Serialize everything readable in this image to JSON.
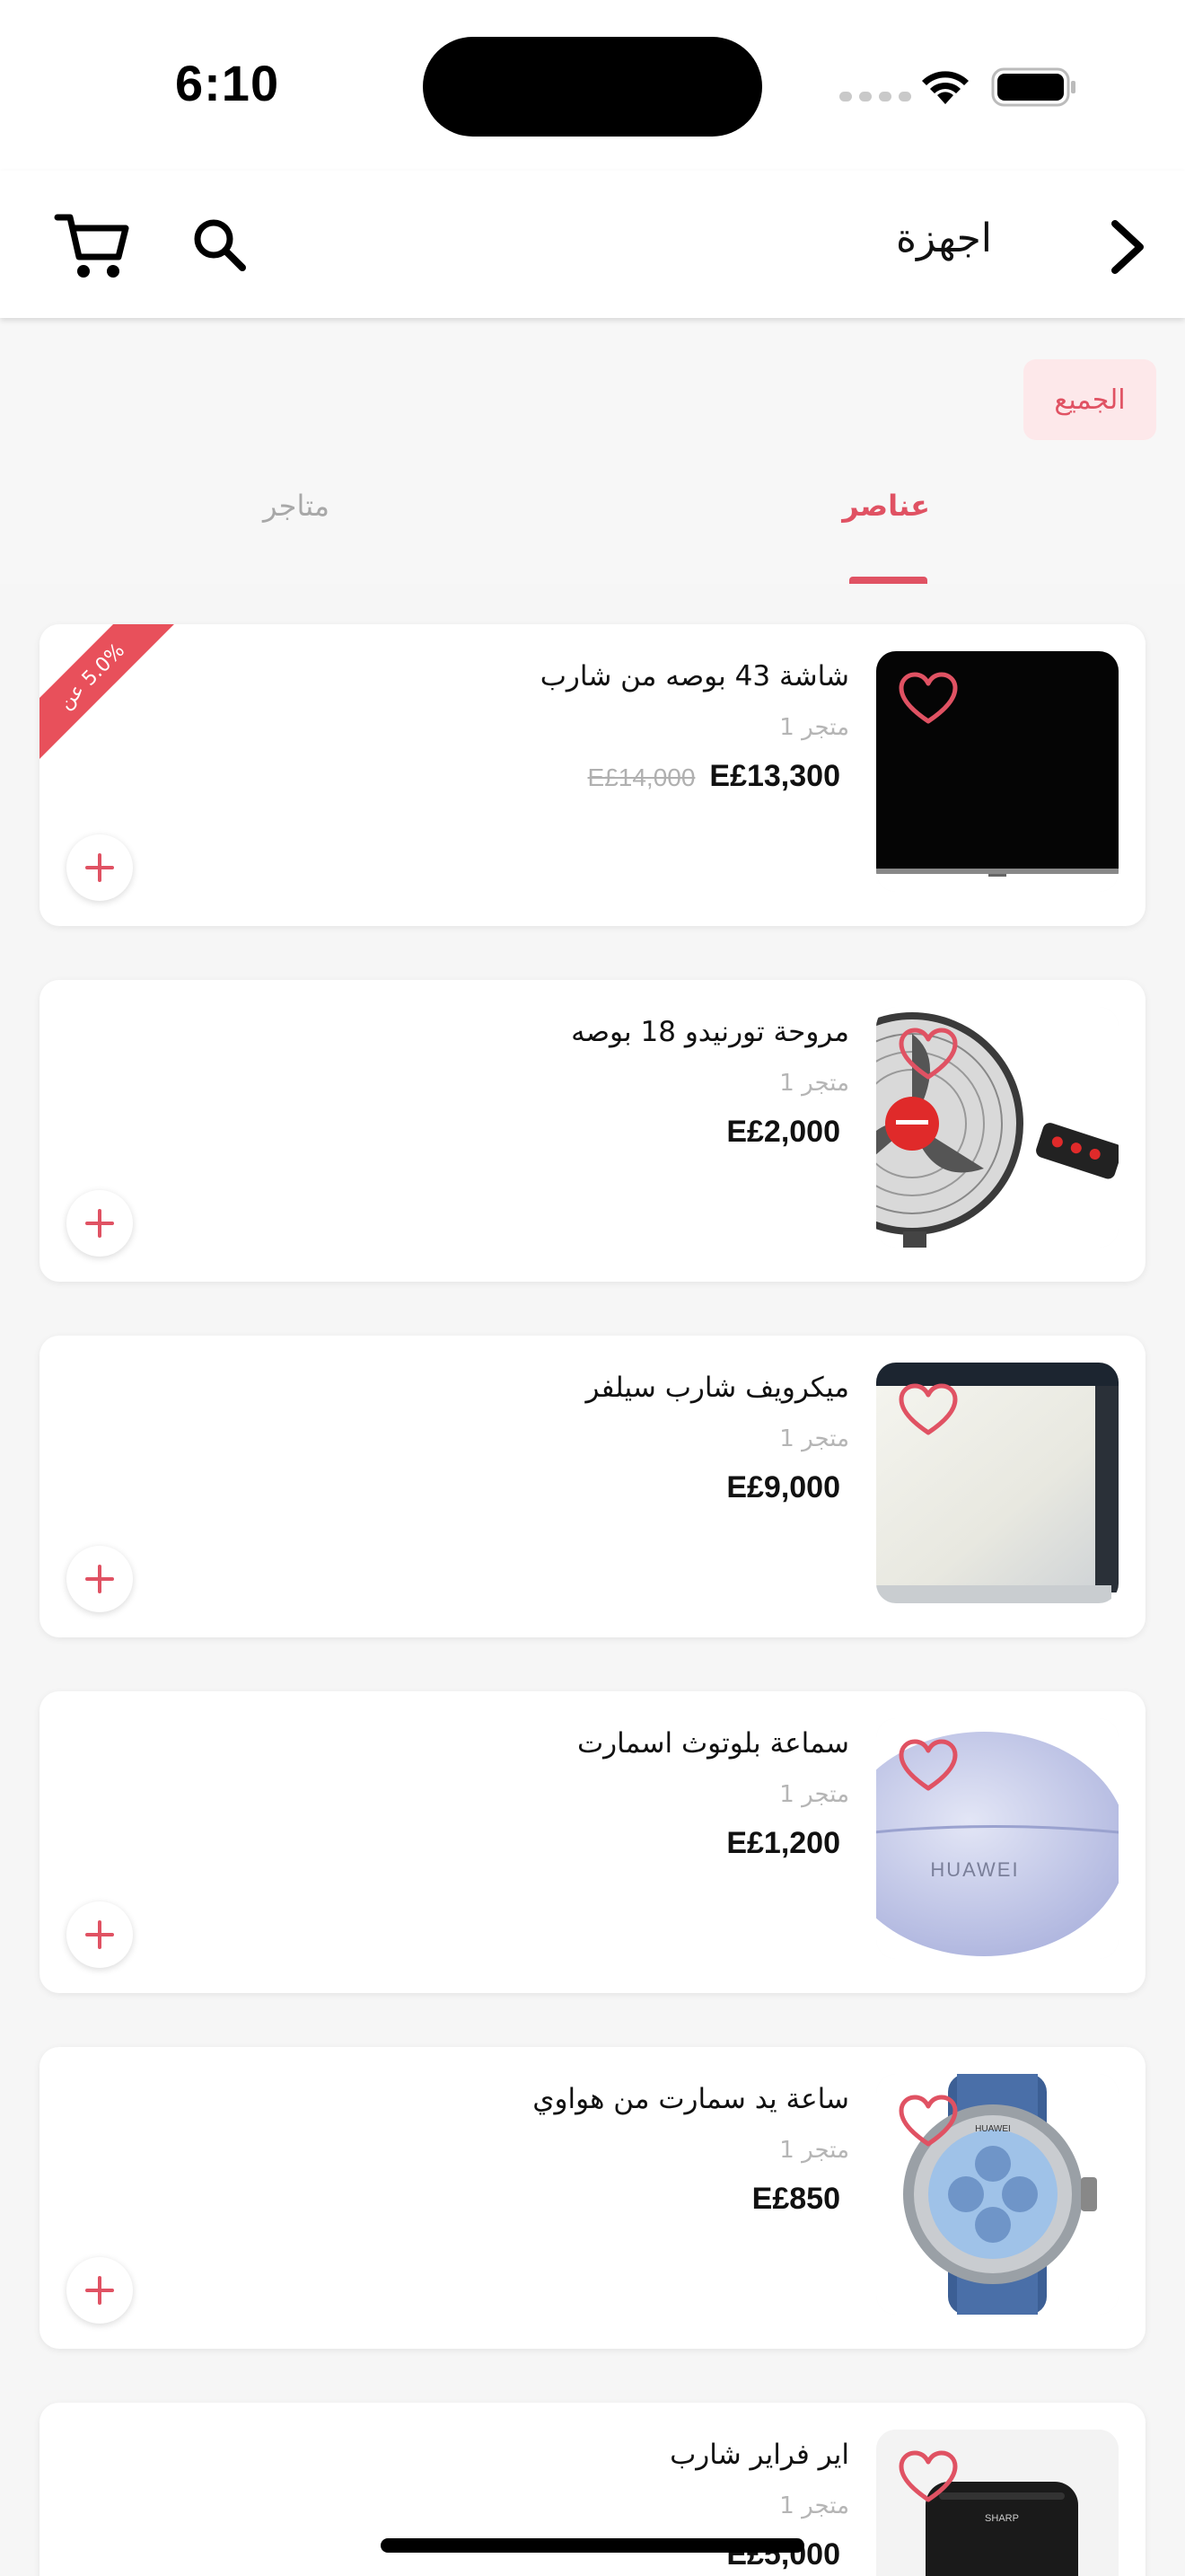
{
  "status_bar": {
    "time": "6:10"
  },
  "header": {
    "title": "اجهزة"
  },
  "filter": {
    "chip_label": "الجميع"
  },
  "tabs": [
    {
      "label": "عناصر",
      "active": true
    },
    {
      "label": "متاجر",
      "active": false
    }
  ],
  "accent_color": "#e05263",
  "products": [
    {
      "name": "شاشة 43 بوصه من شارب",
      "store": "متجر 1",
      "price": "E£13,300",
      "old_price": "E£14,000",
      "discount_badge": "5.0% عن",
      "image": "tv-image"
    },
    {
      "name": "مروحة تورنيدو 18 بوصه",
      "store": "متجر 1",
      "price": "E£2,000",
      "image": "fan-image"
    },
    {
      "name": "ميكرويف شارب سيلفر",
      "store": "متجر 1",
      "price": "E£9,000",
      "image": "microwave-image"
    },
    {
      "name": "سماعة بلوتوث اسمارت",
      "store": "متجر 1",
      "price": "E£1,200",
      "image": "earbuds-case-image",
      "image_text": "HUAWEI"
    },
    {
      "name": "ساعة يد سمارت من هواوي",
      "store": "متجر 1",
      "price": "E£850",
      "image": "smartwatch-image",
      "image_text": "HUAWEI"
    },
    {
      "name": "اير  فراير شارب",
      "store": "متجر 1",
      "price": "E£5,000",
      "image": "air-fryer-image",
      "image_text": "SHARP"
    }
  ]
}
